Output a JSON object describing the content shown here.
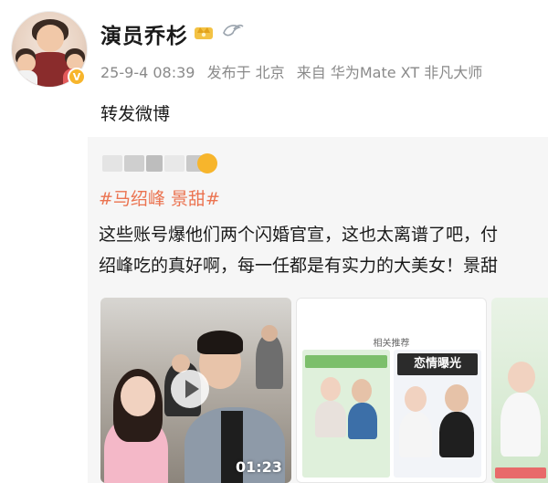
{
  "post": {
    "username": "演员乔杉",
    "timestamp": "25-9-4 08:39",
    "location": "发布于 北京",
    "device": "来自 华为Mate XT 非凡大师",
    "text": "转发微博"
  },
  "repost": {
    "hashtags": "#马绍峰 景甜#",
    "line1": "这些账号爆他们两个闪婚官宣，这也太离谱了吧，付",
    "line2": "绍峰吃的真好啊，每一任都是有实力的大美女！景甜",
    "video_duration": "01:23",
    "thumb2_title": "恋情曝光",
    "thumb2_related": "相关推荐"
  },
  "colors": {
    "hashtag": "#eb7350",
    "verified": "#f7b52c",
    "meta": "#8a8a8a"
  },
  "icons": [
    "crown-icon",
    "bird-icon",
    "verified-icon",
    "play-icon"
  ]
}
